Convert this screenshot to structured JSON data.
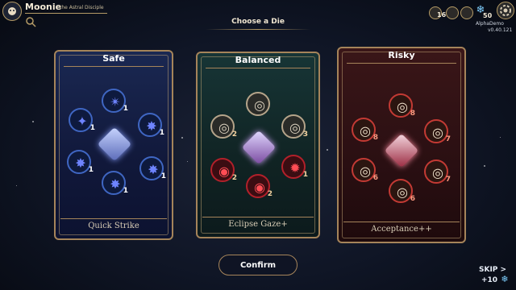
{
  "character": {
    "name": "Moonie",
    "title": "the Astral Disciple"
  },
  "resources": [
    {
      "icon": "dice-icon",
      "value": "16"
    },
    {
      "icon": "token-icon",
      "value": ""
    },
    {
      "icon": "relic-icon",
      "value": ""
    },
    {
      "icon": "snowflake-icon",
      "value": "50"
    }
  ],
  "build": {
    "name": "AlphaDemo",
    "version": "v0.40.121"
  },
  "heading": "Choose a Die",
  "cards": [
    {
      "id": "safe",
      "title": "Safe",
      "die_name": "Quick Strike",
      "faces": [
        {
          "symbol": "✴",
          "value": "1"
        },
        {
          "symbol": "✦",
          "value": "1"
        },
        {
          "symbol": "✸",
          "value": "1"
        },
        {
          "symbol": "✸",
          "value": "1"
        },
        {
          "symbol": "✸",
          "value": "1"
        },
        {
          "symbol": "✸",
          "value": "1"
        }
      ]
    },
    {
      "id": "balanced",
      "title": "Balanced",
      "die_name": "Eclipse Gaze+",
      "faces": [
        {
          "symbol": "◎",
          "value": ""
        },
        {
          "symbol": "◎",
          "value": "2"
        },
        {
          "symbol": "◎",
          "value": "3"
        },
        {
          "symbol": "◉",
          "value": "2"
        },
        {
          "symbol": "✹",
          "value": "1"
        },
        {
          "symbol": "◉",
          "value": "2"
        }
      ]
    },
    {
      "id": "risky",
      "title": "Risky",
      "die_name": "Acceptance++",
      "faces": [
        {
          "symbol": "◎",
          "value": "8"
        },
        {
          "symbol": "◎",
          "value": "8"
        },
        {
          "symbol": "◎",
          "value": "7"
        },
        {
          "symbol": "◎",
          "value": "6"
        },
        {
          "symbol": "◎",
          "value": "7"
        },
        {
          "symbol": "◎",
          "value": "6"
        }
      ]
    }
  ],
  "confirm_label": "Confirm",
  "skip": {
    "label": "SKIP >",
    "reward": "+10"
  },
  "colors": {
    "gold": "#a5845a",
    "safe": "#3f66c2",
    "balanced_red": "#b2202a",
    "risky": "#c33a34"
  }
}
